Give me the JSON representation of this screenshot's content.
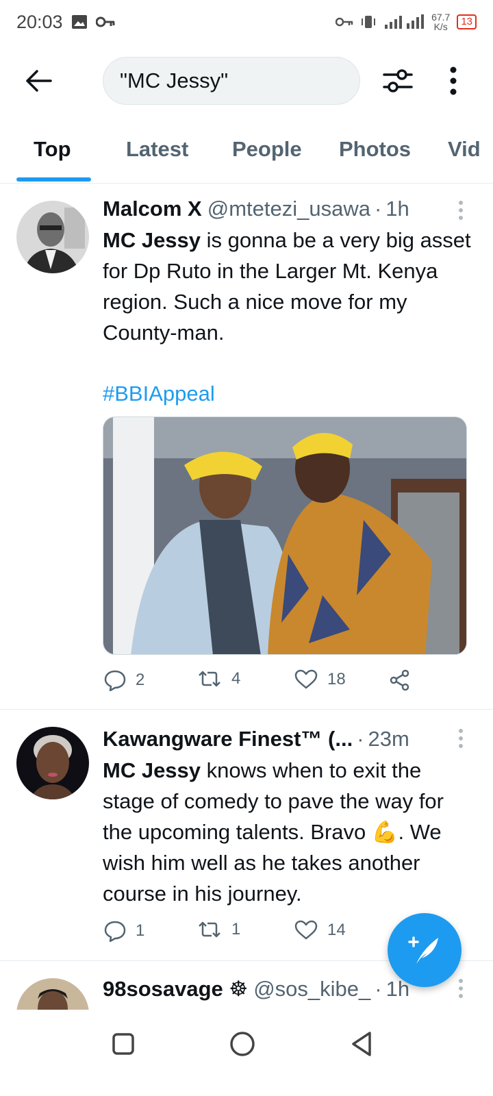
{
  "status_bar": {
    "time": "20:03",
    "net_speed_value": "67.7",
    "net_speed_unit": "K/s",
    "battery": "13"
  },
  "search": {
    "query": "\"MC Jessy\""
  },
  "tabs": [
    "Top",
    "Latest",
    "People",
    "Photos",
    "Vid"
  ],
  "active_tab": "Top",
  "tweets": [
    {
      "name": "Malcom X",
      "handle": "@mtetezi_usawa",
      "sep": "·",
      "time": "1h",
      "text_bold": "MC Jessy",
      "text_rest": " is gonna be a very big asset for Dp Ruto in the Larger Mt. Kenya region. Such a nice move for my County-man.",
      "hashtag": "#BBIAppeal",
      "replies": "2",
      "retweets": "4",
      "likes": "18"
    },
    {
      "name": "Kawangware Finest™ (...",
      "sep": "·",
      "time": "23m",
      "text_bold": "MC Jessy",
      "text_rest": " knows when to exit the stage of comedy to pave the way for the upcoming talents. Bravo 💪. We wish him well as he takes another course in his journey.",
      "replies": "1",
      "retweets": "1",
      "likes": "14"
    },
    {
      "name": "98sosavage ☸",
      "handle": "@sos_kibe_",
      "sep": "·",
      "time": "1h"
    }
  ],
  "colors": {
    "accent": "#1d9bf0",
    "text": "#0f1419",
    "muted": "#536471",
    "battery": "#e0301e"
  }
}
